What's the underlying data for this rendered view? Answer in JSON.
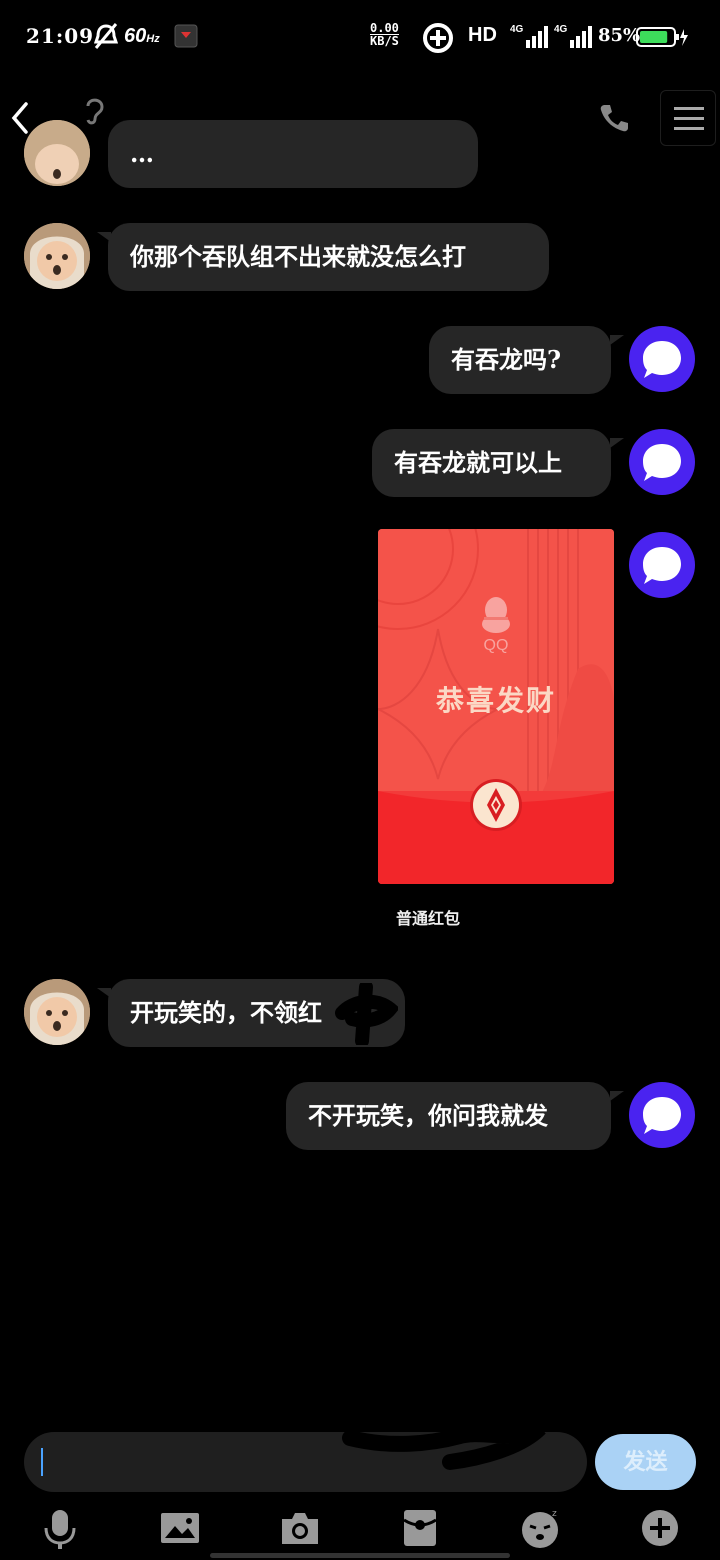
{
  "status_bar": {
    "time": "21:09",
    "refresh_rate": "60",
    "refresh_unit": "Hz",
    "net_rate_value": "0.00",
    "net_rate_unit": "KB/S",
    "hd_label": "HD",
    "signal_1_label": "4G",
    "signal_2_label": "4G",
    "battery_percent": "85%",
    "battery_level": 0.85,
    "battery_color": "#3ddc5b"
  },
  "header": {
    "title_partial": "…"
  },
  "messages": [
    {
      "side": "left",
      "text": "…"
    },
    {
      "side": "left",
      "text": "你那个吞队组不出来就没怎么打"
    },
    {
      "side": "right",
      "text": "有吞龙吗?"
    },
    {
      "side": "right",
      "text": "有吞龙就可以上"
    },
    {
      "side": "right",
      "type": "red_packet",
      "brand": "QQ",
      "greeting": "恭喜发财",
      "caption": "普通红包"
    },
    {
      "side": "left",
      "text": "开玩笑的，不领红"
    },
    {
      "side": "right",
      "text": "不开玩笑，你问我就发"
    }
  ],
  "input": {
    "value": "",
    "send_label": "发送"
  },
  "toolbar": {
    "icons": [
      "microphone-icon",
      "image-icon",
      "camera-icon",
      "red-packet-icon",
      "emoji-icon",
      "plus-icon"
    ]
  },
  "colors": {
    "bubble_bg": "#262626",
    "self_avatar": "#4a23f0",
    "red_packet": "#f2534b",
    "send_button": "#aad2f5"
  }
}
